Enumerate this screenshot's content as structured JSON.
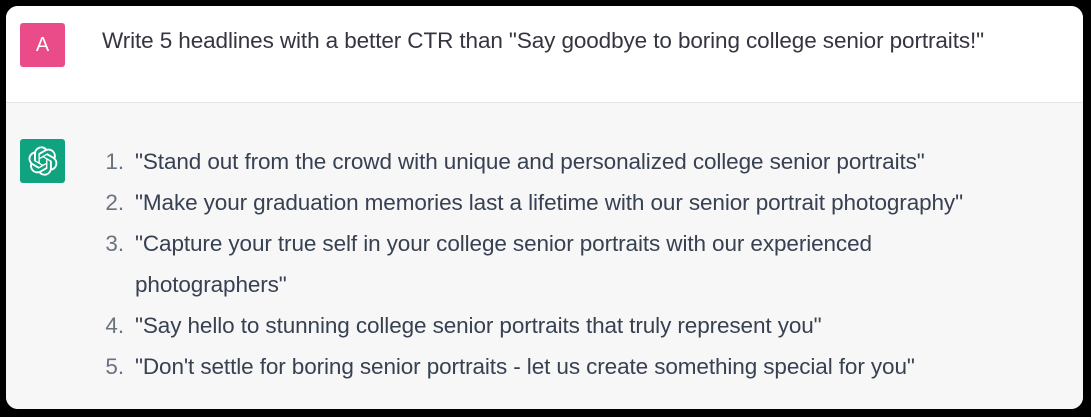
{
  "user_message": {
    "avatar_letter": "A",
    "text": "Write 5 headlines with a better CTR than \"Say goodbye to boring college senior portraits!\""
  },
  "assistant_message": {
    "avatar_icon": "openai-logo-icon",
    "items": [
      {
        "num": "1.",
        "text": "\"Stand out from the crowd with unique and personalized college senior portraits\""
      },
      {
        "num": "2.",
        "text": "\"Make your graduation memories last a lifetime with our senior portrait photography\""
      },
      {
        "num": "3.",
        "text": "\"Capture your true self in your college senior portraits with our experienced photographers\""
      },
      {
        "num": "4.",
        "text": "\"Say hello to stunning college senior portraits that truly represent you\""
      },
      {
        "num": "5.",
        "text": "\"Don't settle for boring senior portraits - let us create something special for you\""
      }
    ]
  },
  "colors": {
    "user_avatar": "#ea4c89",
    "assistant_avatar": "#10a37f",
    "assistant_background": "#f7f7f8",
    "user_background": "#ffffff"
  }
}
